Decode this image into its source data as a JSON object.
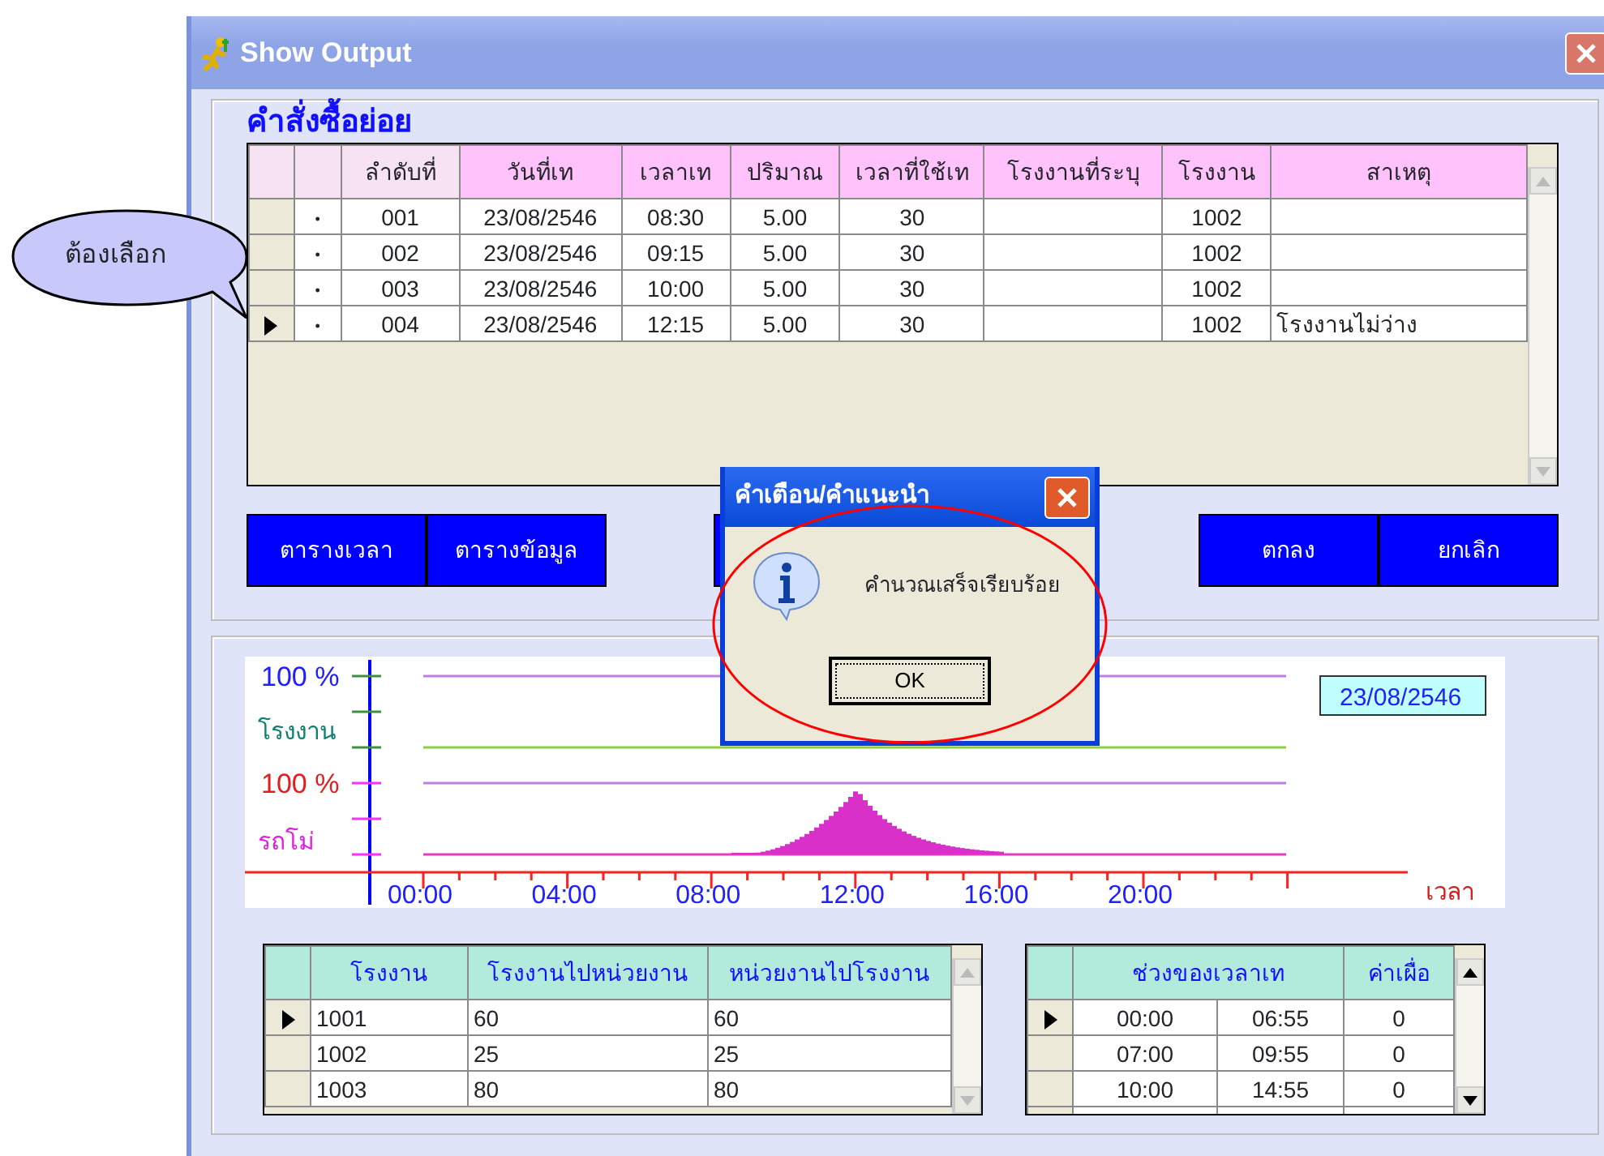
{
  "window": {
    "title": "Show Output"
  },
  "callout": {
    "text": "ต้องเลือก"
  },
  "orders": {
    "title": "คำสั่งซื้อย่อย",
    "columns": [
      "ลำดับที่",
      "วันที่เท",
      "เวลาเท",
      "ปริมาณ",
      "เวลาที่ใช้เท",
      "โรงงานที่ระบุ",
      "โรงงาน",
      "สาเหตุ"
    ],
    "rows": [
      {
        "selected": false,
        "mark": "•",
        "no": "001",
        "date": "23/08/2546",
        "time": "08:30",
        "qty": "5.00",
        "duration": "30",
        "plant": "1002"
      },
      {
        "selected": false,
        "mark": "•",
        "no": "002",
        "date": "23/08/2546",
        "time": "09:15",
        "qty": "5.00",
        "duration": "30",
        "plant": "1002"
      },
      {
        "selected": false,
        "mark": "•",
        "no": "003",
        "date": "23/08/2546",
        "time": "10:00",
        "qty": "5.00",
        "duration": "30",
        "plant": "1002"
      },
      {
        "selected": true,
        "mark": "•",
        "no": "004",
        "date": "23/08/2546",
        "time": "12:15",
        "qty": "5.00",
        "duration": "30",
        "plant": "1002",
        "reason": "โรงงานไม่ว่าง"
      }
    ]
  },
  "buttons_left": [
    "ตารางเวลา",
    "ตารางข้อมูล"
  ],
  "buttons_right": [
    "ตกลง",
    "ยกเลิก"
  ],
  "timeline": {
    "y_labels": [
      {
        "text": "100 %",
        "color": "#2020ff"
      },
      {
        "text": "โรงงาน",
        "color": "#108070"
      },
      {
        "text": "100 %",
        "color": "#e02020"
      },
      {
        "text": "รถโม่",
        "color": "#e020e0"
      }
    ],
    "x_labels": [
      "00:00",
      "04:00",
      "08:00",
      "12:00",
      "16:00",
      "20:00"
    ],
    "axis_title": "เวลา",
    "date": "23/08/2546"
  },
  "plants": {
    "columns": [
      "โรงงาน",
      "โรงงานไปหน่วยงาน",
      "หน่วยงานไปโรงงาน"
    ],
    "rows": [
      {
        "selected": true,
        "plant": "1001",
        "to_site": "60",
        "to_plant": "60"
      },
      {
        "selected": false,
        "plant": "1002",
        "to_site": "25",
        "to_plant": "25"
      },
      {
        "selected": false,
        "plant": "1003",
        "to_site": "80",
        "to_plant": "80"
      }
    ]
  },
  "periods": {
    "columns": [
      "ช่วงของเวลาเท",
      "ค่าเผื่อ"
    ],
    "rows": [
      {
        "selected": true,
        "start": "00:00",
        "end": "06:55",
        "allowance": "0"
      },
      {
        "selected": false,
        "start": "07:00",
        "end": "09:55",
        "allowance": "0"
      },
      {
        "selected": false,
        "start": "10:00",
        "end": "14:55",
        "allowance": "0"
      }
    ]
  },
  "dialog": {
    "title": "คำเตือน/คำแนะนำ",
    "message": "คำนวณเสร็จเรียบร้อย",
    "button": "OK"
  }
}
